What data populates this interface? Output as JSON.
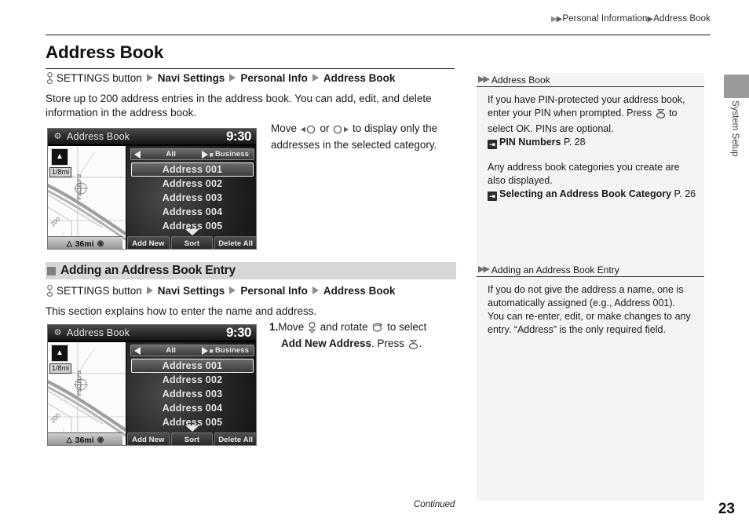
{
  "breadcrumb": {
    "segments": [
      "Personal Information",
      "Address Book"
    ]
  },
  "page": {
    "title": "Address Book",
    "number": "23",
    "continued_label": "Continued",
    "vertical_tab": "System Setup"
  },
  "navpath": {
    "button_label": "SETTINGS button",
    "steps": [
      "Navi Settings",
      "Personal Info",
      "Address Book"
    ]
  },
  "intro": {
    "text": "Store up to 200 address entries in the address book. You can add, edit, and delete information in the address book."
  },
  "section": {
    "heading": "Adding an Address Book Entry",
    "text": "This section explains how to enter the name and address."
  },
  "note_1": {
    "part_a": "Move ",
    "part_b": " or ",
    "part_c": " to display only the addresses in the selected category."
  },
  "note_2": {
    "step": "1.",
    "part_a": "Move ",
    "part_b": " and rotate ",
    "part_c": " to select",
    "bold_target": "Add New Address",
    "part_d": ". Press ",
    "part_e": "."
  },
  "navshot": {
    "title": "Address Book",
    "clock": "9:30",
    "scale_label": "1/8mi",
    "map_scale": "36mi",
    "street_label": "RAMONA",
    "road_number": "200",
    "category_left": "All",
    "category_right": "Business",
    "entries": [
      "Address 001",
      "Address 002",
      "Address 003",
      "Address 004",
      "Address 005"
    ],
    "selected_index": 0,
    "buttons": [
      "Add New",
      "Sort",
      "Delete All"
    ]
  },
  "sidebar": {
    "sections": [
      {
        "heading": "Address Book",
        "paragraphs": [
          "If you have PIN-protected your address book, enter your PIN when prompted. Press ",
          " to select OK. PINs are optional."
        ],
        "reference_1": {
          "label": "PIN Numbers",
          "page": "P. 28"
        },
        "paragraph_2": "Any address book categories you create are also displayed.",
        "reference_2": {
          "label": "Selecting an Address Book Category",
          "page": "P. 26"
        }
      },
      {
        "heading": "Adding an Address Book Entry",
        "paragraph": "If you do not give the address a name, one is automatically assigned (e.g., Address 001). You can re-enter, edit, or make changes to any entry. “Address” is the only required field."
      }
    ]
  },
  "colors": {
    "heading_band": "#d7d7d7",
    "sidebar_bg": "#f4f4f4",
    "arrow_gray": "#8c8c8c",
    "tab_gray": "#9a9a9a"
  }
}
